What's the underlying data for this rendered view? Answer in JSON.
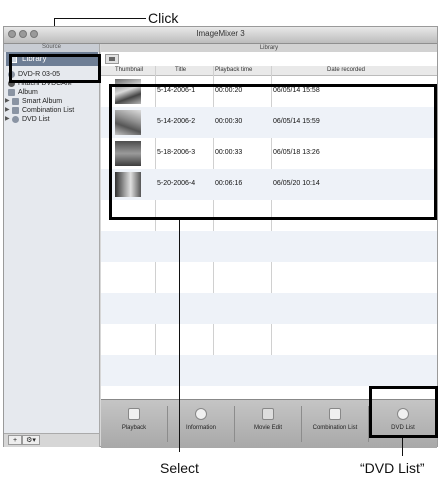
{
  "callouts": {
    "click": "Click",
    "select": "Select",
    "dvd_list": "“DVD List”"
  },
  "window": {
    "title": "ImageMixer 3"
  },
  "sidebar": {
    "header": "Source",
    "library_label": "Library",
    "tree": [
      {
        "label": "DVD-R  03-05",
        "indent": 0,
        "icon": "disc-icon",
        "has_triangle": false
      },
      {
        "label": "Hitachi DVDCAM",
        "indent": 0,
        "icon": "camera-icon",
        "has_triangle": false
      },
      {
        "label": "Album",
        "indent": 0,
        "icon": "album-icon",
        "has_triangle": false
      },
      {
        "label": "Smart Album",
        "indent": 1,
        "icon": "smart-album-icon",
        "has_triangle": true
      },
      {
        "label": "Combination List",
        "indent": 1,
        "icon": "combination-list-icon",
        "has_triangle": true
      },
      {
        "label": "DVD List",
        "indent": 1,
        "icon": "dvd-list-icon",
        "has_triangle": true
      }
    ],
    "footer": {
      "add": "+",
      "action": "⚙▾"
    }
  },
  "main": {
    "header": "Library",
    "columns": [
      "Thumbnail",
      "Title",
      "Playback time",
      "Date recorded"
    ],
    "rows": [
      {
        "title": "5-14-2006-1",
        "time": "00:00:20",
        "date": "06/05/14 15:58"
      },
      {
        "title": "5-14-2006-2",
        "time": "00:00:30",
        "date": "06/05/14 15:59"
      },
      {
        "title": "5-18-2006-3",
        "time": "00:00:33",
        "date": "06/05/18 13:26"
      },
      {
        "title": "5-20-2006-4",
        "time": "00:06:16",
        "date": "06/05/20 10:14"
      }
    ],
    "toolbar": [
      {
        "label": "Playback",
        "icon": "playback-icon"
      },
      {
        "label": "Information",
        "icon": "information-icon"
      },
      {
        "label": "Movie Edit",
        "icon": "movie-edit-icon"
      },
      {
        "label": "Combination List",
        "icon": "combination-list-icon"
      },
      {
        "label": "DVD List",
        "icon": "dvd-list-icon"
      }
    ]
  }
}
